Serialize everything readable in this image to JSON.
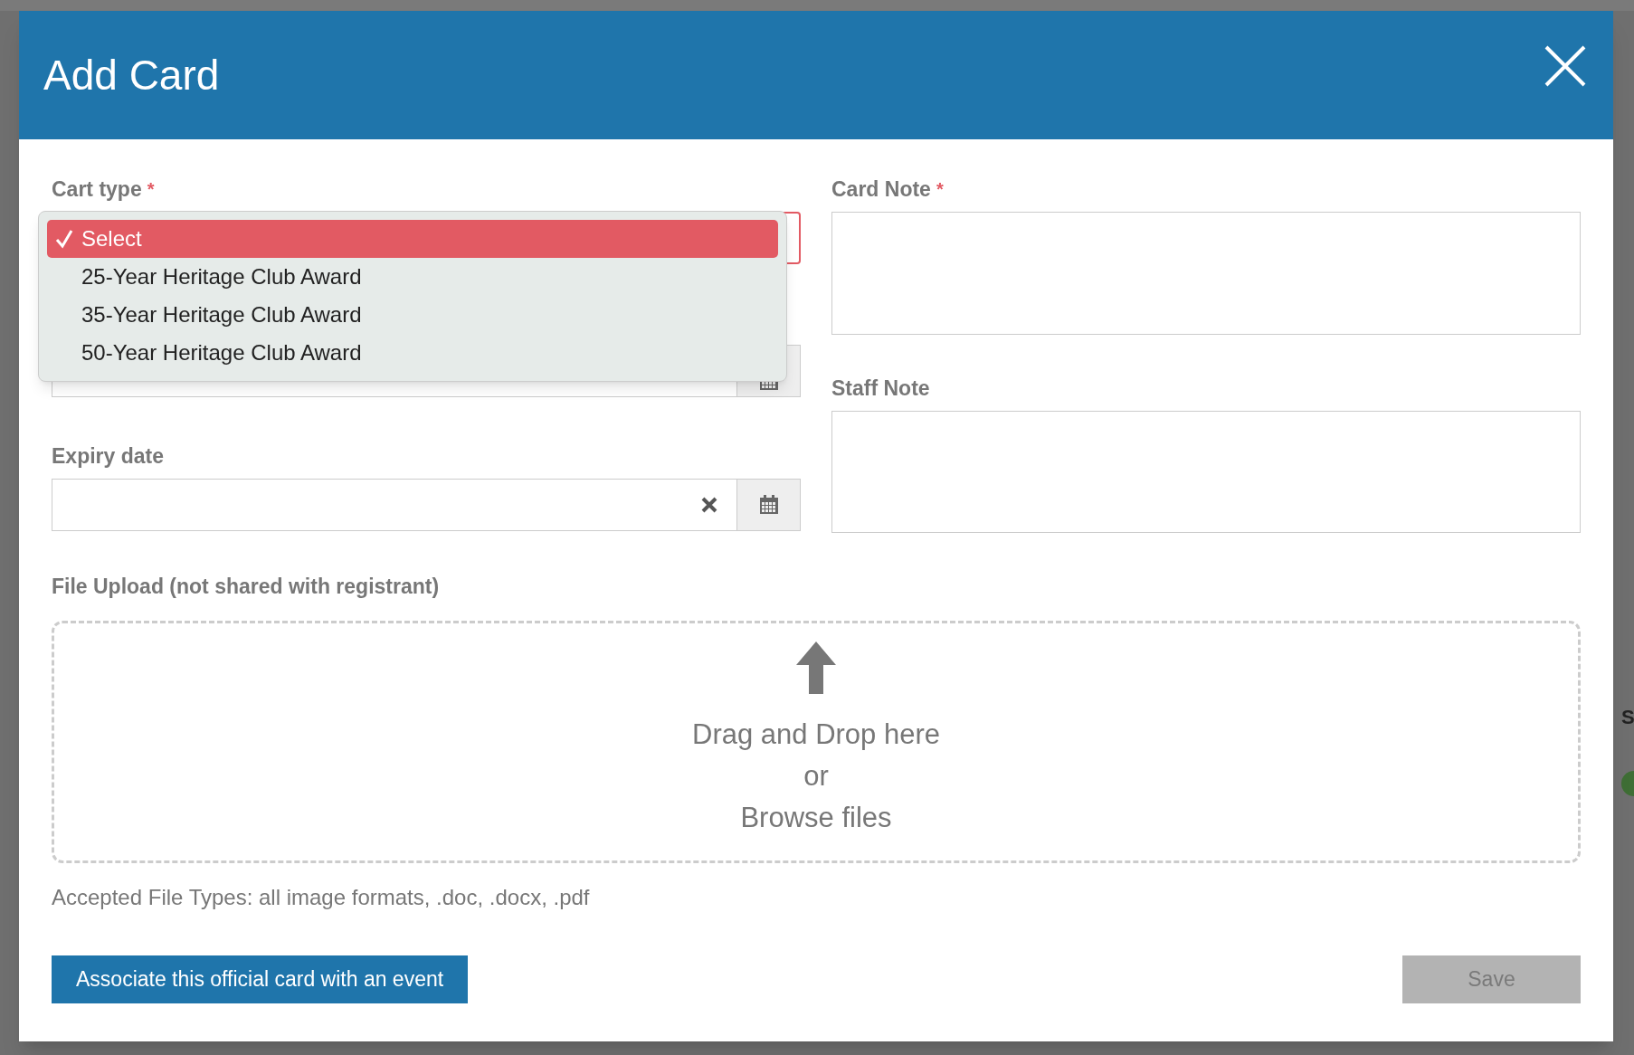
{
  "background": {
    "side_text": "S"
  },
  "modal": {
    "title": "Add Card",
    "cart_type": {
      "label": "Cart type",
      "required_mark": "*",
      "options": [
        {
          "label": "Select",
          "selected": true
        },
        {
          "label": "25-Year Heritage Club Award",
          "selected": false
        },
        {
          "label": "35-Year Heritage Club Award",
          "selected": false
        },
        {
          "label": "50-Year Heritage Club Award",
          "selected": false
        }
      ]
    },
    "expiry_date": {
      "label": "Expiry date"
    },
    "card_note": {
      "label": "Card Note",
      "required_mark": "*"
    },
    "staff_note": {
      "label": "Staff Note"
    },
    "file_upload": {
      "label": "File Upload (not shared with registrant)",
      "lines": [
        "Drag and Drop here",
        "or",
        "Browse files"
      ],
      "accepted": "Accepted File Types: all image formats, .doc, .docx, .pdf"
    },
    "buttons": [
      {
        "label": "Associate this official card with an event",
        "disabled": false
      },
      {
        "label": "Save",
        "disabled": true
      }
    ]
  }
}
